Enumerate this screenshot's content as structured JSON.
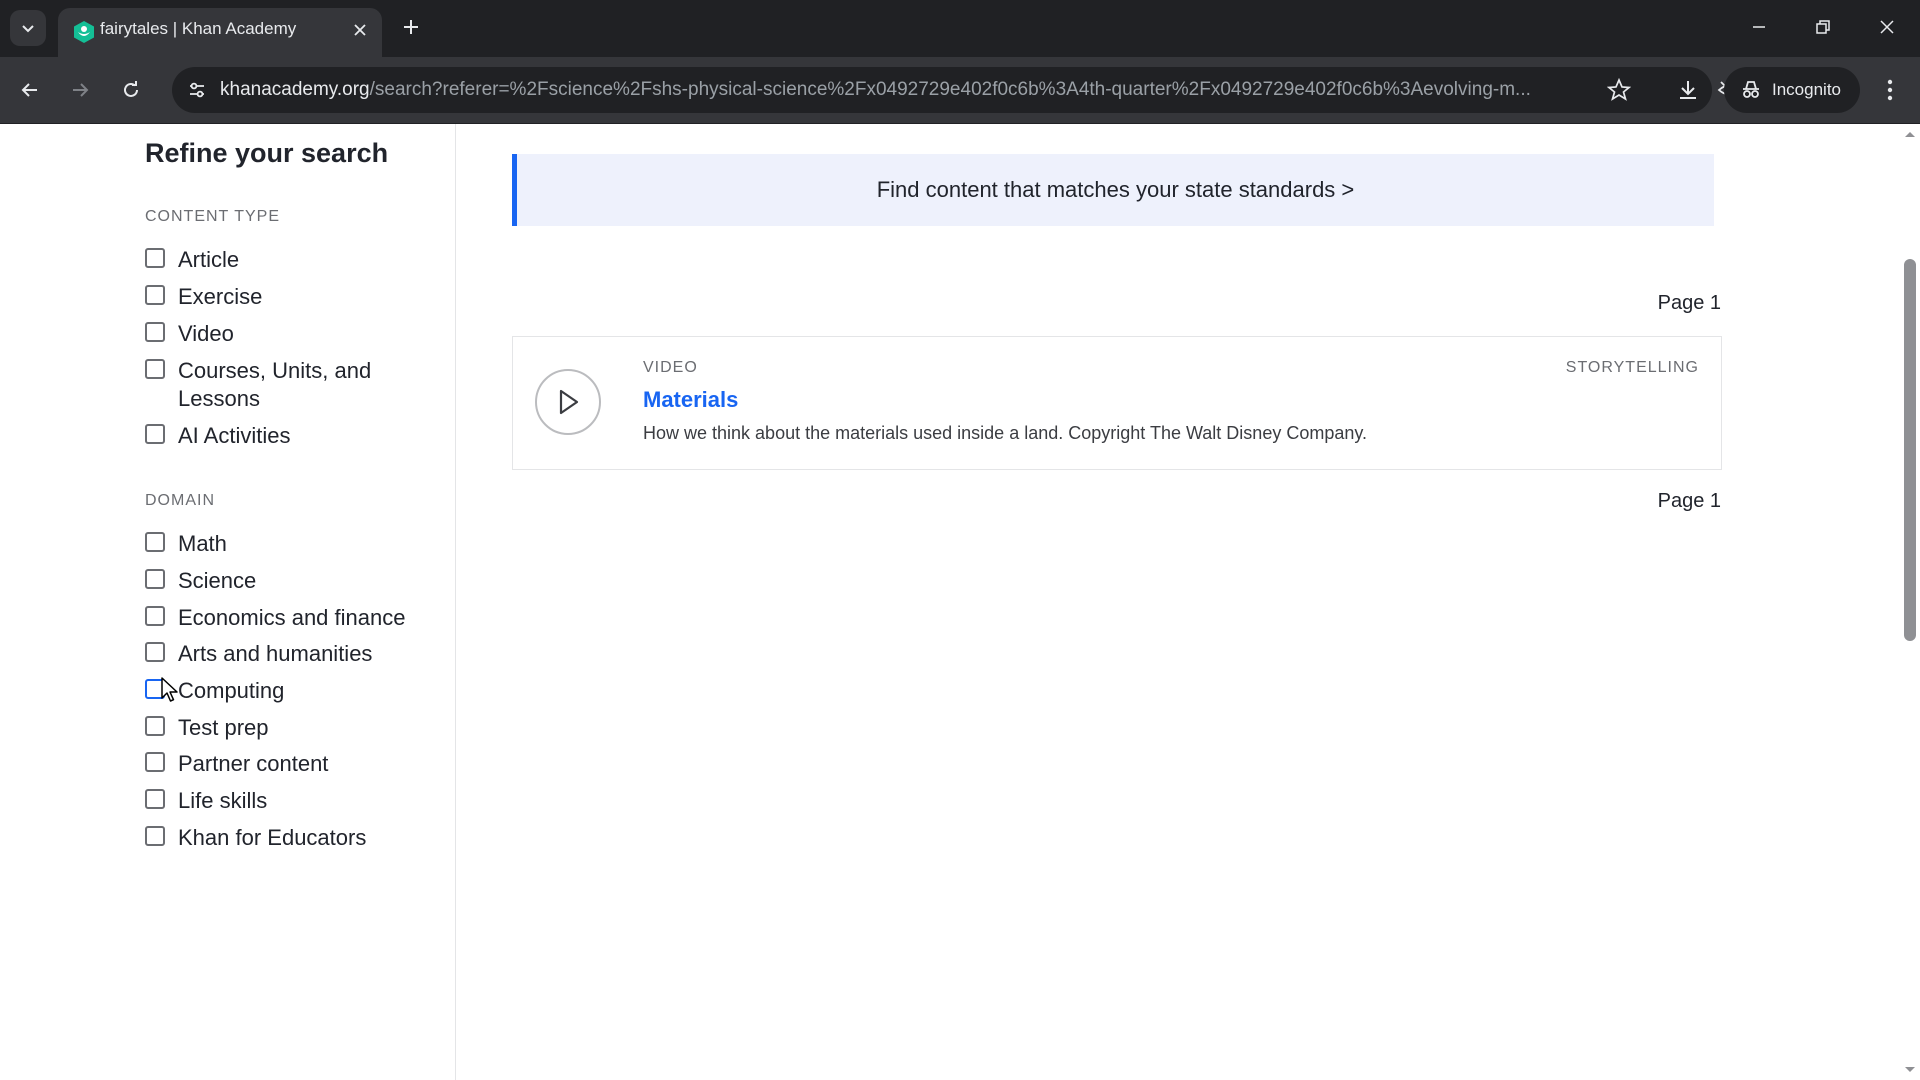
{
  "browser": {
    "tab_title": "fairytales | Khan Academy",
    "url_host": "khanacademy.org",
    "url_rest": "/search?referer=%2Fscience%2Fshs-physical-science%2Fx0492729e402f0c6b%3A4th-quarter%2Fx0492729e402f0c6b%3Aevolving-m...",
    "incognito_label": "Incognito"
  },
  "sidebar": {
    "title": "Refine your search",
    "content_type": {
      "label": "CONTENT TYPE",
      "items": [
        {
          "label": "Article",
          "checked": false
        },
        {
          "label": "Exercise",
          "checked": false
        },
        {
          "label": "Video",
          "checked": false
        },
        {
          "label": "Courses, Units, and Lessons",
          "checked": false
        },
        {
          "label": "AI Activities",
          "checked": false
        }
      ]
    },
    "domain": {
      "label": "DOMAIN",
      "items": [
        {
          "label": "Math",
          "checked": false
        },
        {
          "label": "Science",
          "checked": false
        },
        {
          "label": "Economics and finance",
          "checked": false
        },
        {
          "label": "Arts and humanities",
          "checked": false
        },
        {
          "label": "Computing",
          "checked": false
        },
        {
          "label": "Test prep",
          "checked": false
        },
        {
          "label": "Partner content",
          "checked": false
        },
        {
          "label": "Life skills",
          "checked": false
        },
        {
          "label": "Khan for Educators",
          "checked": false
        }
      ]
    }
  },
  "main": {
    "banner_text": "Find content that matches your state standards >",
    "page_top": "Page 1",
    "page_bottom": "Page 1",
    "results": [
      {
        "type": "VIDEO",
        "tag": "STORYTELLING",
        "title": "Materials",
        "description": "How we think about the materials used inside a land. Copyright The Walt Disney Company."
      }
    ]
  },
  "colors": {
    "accent": "#1865f2",
    "banner_bg": "#eef1fc",
    "chrome_dark": "#202124",
    "chrome_toolbar": "#35363a"
  }
}
